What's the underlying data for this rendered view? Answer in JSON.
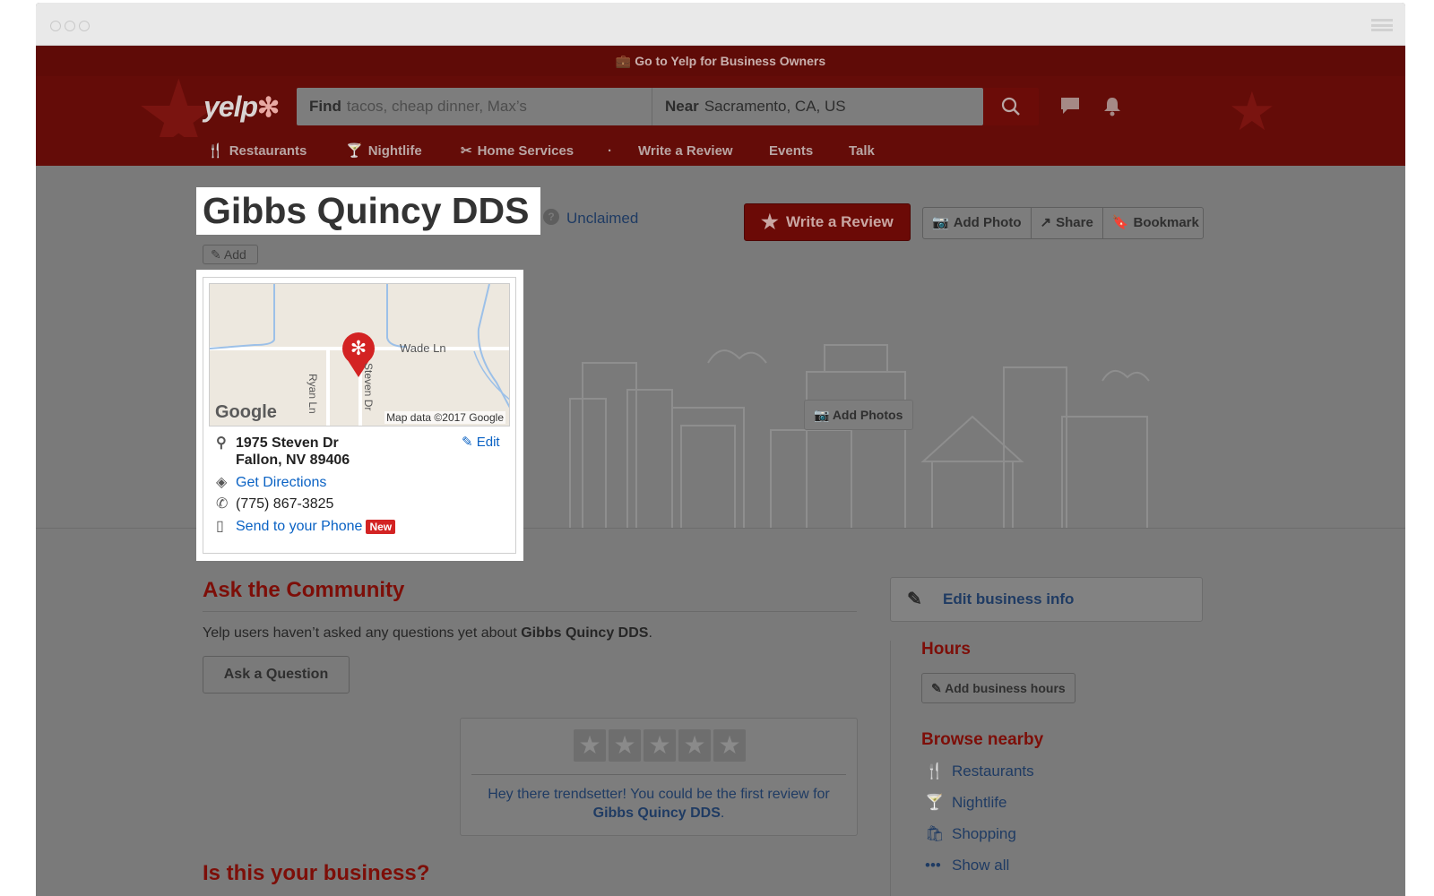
{
  "topbar": {
    "label": "Go to Yelp for Business Owners"
  },
  "header": {
    "logo": "yelp",
    "find_label": "Find",
    "find_placeholder": "tacos, cheap dinner, Max’s",
    "near_label": "Near",
    "near_value": "Sacramento, CA, US"
  },
  "nav": {
    "items": [
      {
        "label": "Restaurants",
        "icon": "fork-knife-icon"
      },
      {
        "label": "Nightlife",
        "icon": "cocktail-icon"
      },
      {
        "label": "Home Services",
        "icon": "tools-icon"
      },
      {
        "label": "Write a Review"
      },
      {
        "label": "Events"
      },
      {
        "label": "Talk"
      }
    ]
  },
  "business": {
    "name": "Gibbs Quincy DDS",
    "claim_status": "Unclaimed",
    "add_category_label": "Add",
    "write_review_label": "Write a Review",
    "actions": [
      "Add Photo",
      "Share",
      "Bookmark"
    ],
    "add_photos_label": "Add Photos"
  },
  "map": {
    "street_labels": [
      "Wade Ln",
      "Ryan Ln",
      "Steven Dr"
    ],
    "attribution": "Map data ©2017 Google",
    "provider": "Google"
  },
  "location": {
    "address_line1": "1975 Steven Dr",
    "address_line2": "Fallon, NV 89406",
    "edit_label": "Edit",
    "directions_label": "Get Directions",
    "phone": "(775) 867-3825",
    "send_label": "Send to your Phone",
    "new_badge": "New"
  },
  "community": {
    "title": "Ask the Community",
    "text_prefix": "Yelp users haven’t asked any questions yet about ",
    "text_bold": "Gibbs Quincy DDS",
    "text_suffix": ".",
    "ask_button": "Ask a Question"
  },
  "first_review": {
    "line1": "Hey there trendsetter! You could be the first review for",
    "line2_bold": "Gibbs Quincy DDS",
    "line2_suffix": "."
  },
  "is_your_business": {
    "title": "Is this your business?"
  },
  "sidebar": {
    "edit_info_label": "Edit business info",
    "hours_title": "Hours",
    "add_hours_label": "Add business hours",
    "browse_title": "Browse nearby",
    "browse_items": [
      {
        "label": "Restaurants",
        "icon": "fork-knife-icon"
      },
      {
        "label": "Nightlife",
        "icon": "cocktail-icon"
      },
      {
        "label": "Shopping",
        "icon": "shopping-bag-icon"
      },
      {
        "label": "Show all",
        "icon": "more-dots-icon"
      }
    ]
  },
  "colors": {
    "brand_red": "#d32323",
    "link_blue": "#0a62c4"
  }
}
